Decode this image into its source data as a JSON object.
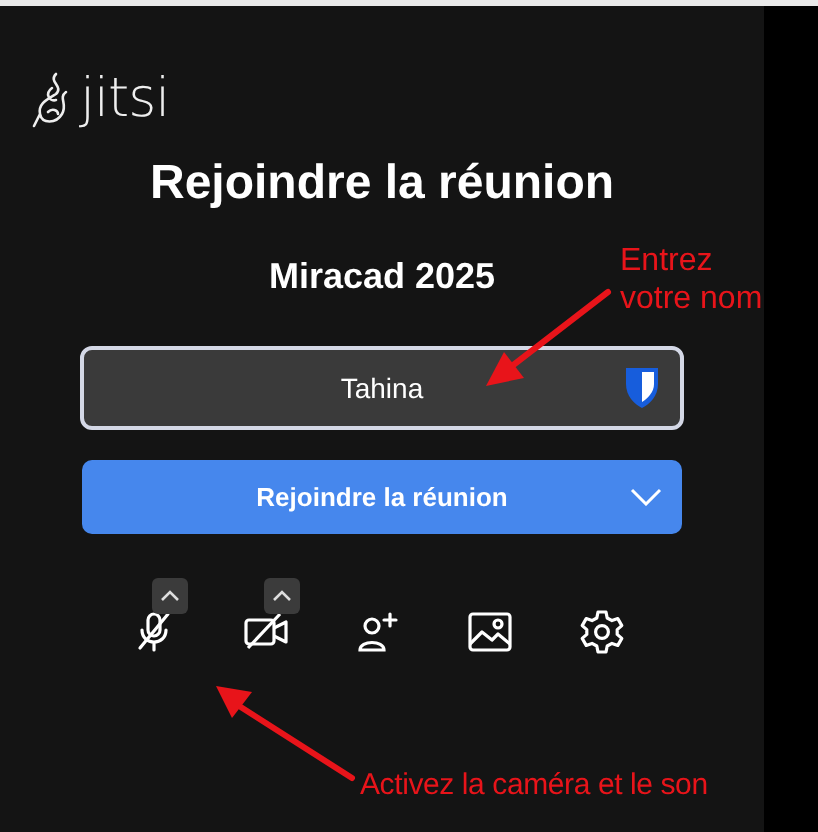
{
  "logo": {
    "text": "jitsi"
  },
  "title": "Rejoindre la réunion",
  "meeting_name": "Miracad 2025",
  "name_field": {
    "value": "Tahina"
  },
  "join_button": {
    "label": "Rejoindre la réunion"
  },
  "toolbar": [
    {
      "kind": "microphone",
      "off": true,
      "has_menu": true
    },
    {
      "kind": "camera",
      "off": true,
      "has_menu": true
    },
    {
      "kind": "invite",
      "has_menu": false
    },
    {
      "kind": "background",
      "has_menu": false
    },
    {
      "kind": "settings",
      "has_menu": false
    }
  ],
  "annotations": [
    {
      "lines": [
        "Entrez",
        "votre nom"
      ]
    },
    {
      "lines": [
        "Activez la caméra et le son"
      ]
    }
  ]
}
